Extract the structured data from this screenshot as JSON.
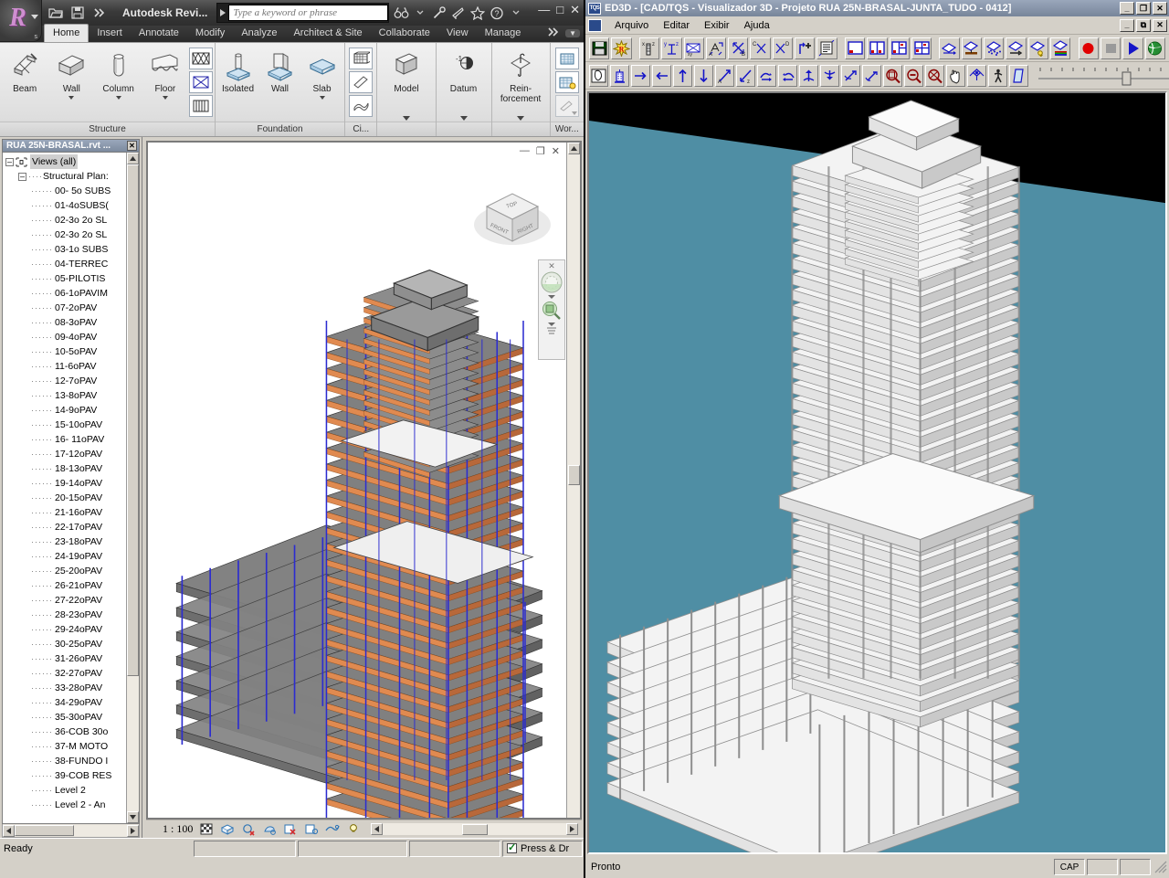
{
  "revit": {
    "app_title": "Autodesk Revi...",
    "search_placeholder": "Type a keyword or phrase",
    "window_buttons": {
      "minimize": "—",
      "maximize": "□",
      "close": "✕"
    },
    "quick_access": [
      {
        "name": "open-icon",
        "label": "Open"
      },
      {
        "name": "save-icon",
        "label": "Save"
      },
      {
        "name": "qat-more-icon",
        "label": "More"
      }
    ],
    "title_icons": [
      {
        "name": "infocenter-search-icon",
        "label": "Search"
      },
      {
        "name": "subscription-icon",
        "label": "Subscription Center"
      },
      {
        "name": "communication-icon",
        "label": "Communication Center"
      },
      {
        "name": "favorites-icon",
        "label": "Favorites"
      },
      {
        "name": "help-icon",
        "label": "Help"
      }
    ],
    "tabs": [
      {
        "label": "Home",
        "active": true
      },
      {
        "label": "Insert",
        "active": false
      },
      {
        "label": "Annotate",
        "active": false
      },
      {
        "label": "Modify",
        "active": false
      },
      {
        "label": "Analyze",
        "active": false
      },
      {
        "label": "Architect & Site",
        "active": false
      },
      {
        "label": "Collaborate",
        "active": false
      },
      {
        "label": "View",
        "active": false
      },
      {
        "label": "Manage",
        "active": false
      }
    ],
    "ribbon_panels": [
      {
        "label": "Structure",
        "buttons": [
          {
            "label": "Beam",
            "icon": "beam-icon",
            "dropdown": false
          },
          {
            "label": "Wall",
            "icon": "structural-wall-icon",
            "dropdown": true
          },
          {
            "label": "Column",
            "icon": "column-icon",
            "dropdown": true
          },
          {
            "label": "Floor",
            "icon": "floor-icon",
            "dropdown": true
          }
        ],
        "mini_buttons": [
          {
            "icon": "truss-icon"
          },
          {
            "icon": "brace-icon"
          },
          {
            "icon": "beam-system-icon"
          }
        ]
      },
      {
        "label": "Foundation",
        "buttons": [
          {
            "label": "Isolated",
            "icon": "isolated-foundation-icon",
            "dropdown": false
          },
          {
            "label": "Wall",
            "icon": "wall-foundation-icon",
            "dropdown": false
          },
          {
            "label": "Slab",
            "icon": "slab-foundation-icon",
            "dropdown": true
          }
        ],
        "mini_buttons": []
      },
      {
        "label": "Ci...",
        "buttons": [],
        "mini_buttons": [
          {
            "icon": "rebar-mesh-icon"
          },
          {
            "icon": "cover-icon"
          },
          {
            "icon": "area-reinforcement-icon"
          }
        ]
      },
      {
        "label": "",
        "buttons": [
          {
            "label": "Model",
            "icon": "model-icon",
            "dropdown": false
          }
        ],
        "mini_buttons": [],
        "panel_dropdown": true
      },
      {
        "label": "",
        "buttons": [
          {
            "label": "Datum",
            "icon": "datum-icon",
            "dropdown": false
          }
        ],
        "mini_buttons": [],
        "panel_dropdown": true
      },
      {
        "label": "",
        "buttons": [
          {
            "label": "Rein-\nforcement",
            "icon": "reinforcement-icon",
            "dropdown": false
          }
        ],
        "mini_buttons": [],
        "panel_dropdown": true
      },
      {
        "label": "Wor...",
        "buttons": [],
        "mini_buttons": [
          {
            "icon": "workset-icon"
          },
          {
            "icon": "active-workset-icon"
          },
          {
            "icon": "edit-workset-icon"
          }
        ]
      }
    ],
    "browser": {
      "title": "RUA 25N-BRASAL.rvt ...",
      "close_label": "✕",
      "root": "Views (all)",
      "group": "Structural Plan:",
      "views": [
        "00- 5o SUBS",
        "01-4oSUBS(",
        "02-3o 2o SL",
        "02-3o 2o SL",
        "03-1o SUBS",
        "04-TERREC",
        "05-PILOTIS",
        "06-1oPAVIM",
        "07-2oPAV",
        "08-3oPAV",
        "09-4oPAV",
        "10-5oPAV",
        "11-6oPAV",
        "12-7oPAV",
        "13-8oPAV",
        "14-9oPAV",
        "15-10oPAV",
        "16- 11oPAV",
        "17-12oPAV",
        "18-13oPAV",
        "19-14oPAV",
        "20-15oPAV",
        "21-16oPAV",
        "22-17oPAV",
        "23-18oPAV",
        "24-19oPAV",
        "25-20oPAV",
        "26-21oPAV",
        "27-22oPAV",
        "28-23oPAV",
        "29-24oPAV",
        "30-25oPAV",
        "31-26oPAV",
        "32-27oPAV",
        "33-28oPAV",
        "34-29oPAV",
        "35-30oPAV",
        "36-COB 30o",
        "37-M MOTO",
        "38-FUNDO I",
        "39-COB RES",
        "Level 2",
        "Level 2 - An"
      ]
    },
    "view_controls": {
      "scale": "1 : 100",
      "icons": [
        {
          "name": "detail-level-icon"
        },
        {
          "name": "visual-style-icon"
        },
        {
          "name": "sun-path-icon"
        },
        {
          "name": "shadows-icon"
        },
        {
          "name": "render-crop-icon"
        },
        {
          "name": "hide-isolate-icon"
        },
        {
          "name": "reveal-hidden-icon"
        },
        {
          "name": "temporary-view-icon"
        }
      ]
    },
    "mdi_buttons": {
      "minimize": "—",
      "restore": "❐",
      "close": "✕"
    },
    "status_text": "Ready",
    "press_drag_label": "Press & Dr",
    "viewcube": {
      "top": "TOP",
      "front": "FRONT",
      "right": "RIGHT"
    },
    "navbar": {
      "close": "✕",
      "items": [
        {
          "name": "steering-wheel-icon"
        },
        {
          "name": "zoom-tools-icon"
        },
        {
          "name": "navbar-customize-icon"
        }
      ]
    }
  },
  "ed3d": {
    "title": "ED3D - [CAD/TQS - Visualizador 3D - Projeto RUA 25N-BRASAL-JUNTA_TUDO - 0412]",
    "app_icon_label": "TQS",
    "window_buttons": {
      "minimize": "_",
      "maximize": "❐",
      "close": "✕"
    },
    "mdi_buttons": {
      "minimize": "_",
      "restore": "⧉",
      "close": "✕"
    },
    "menus": [
      {
        "label": "Arquivo"
      },
      {
        "label": "Editar"
      },
      {
        "label": "Exibir"
      },
      {
        "label": "Ajuda"
      }
    ],
    "toolbar_row1": [
      {
        "name": "save-icon",
        "group": 0
      },
      {
        "name": "refresh-icon",
        "group": 0
      },
      {
        "name": "view-xz-icon",
        "group": 1
      },
      {
        "name": "view-yz-icon",
        "group": 1
      },
      {
        "name": "view-xy-icon",
        "group": 1
      },
      {
        "name": "view-a-icon",
        "group": 1
      },
      {
        "name": "view-b-icon",
        "group": 1
      },
      {
        "name": "view-c-icon",
        "group": 1
      },
      {
        "name": "view-d-icon",
        "group": 1
      },
      {
        "name": "add-view-icon",
        "group": 1
      },
      {
        "name": "list-views-icon",
        "group": 1
      },
      {
        "name": "single-window-icon",
        "group": 2
      },
      {
        "name": "split-vertical-icon",
        "group": 2
      },
      {
        "name": "split-three-icon",
        "group": 2
      },
      {
        "name": "split-four-icon",
        "group": 2
      },
      {
        "name": "shade-flat-icon",
        "group": 3
      },
      {
        "name": "shade-section-icon",
        "group": 3
      },
      {
        "name": "shade-mesh-icon",
        "group": 3
      },
      {
        "name": "shade-arrow-icon",
        "group": 3
      },
      {
        "name": "shade-light-icon",
        "group": 3
      },
      {
        "name": "shade-color-icon",
        "group": 3
      },
      {
        "name": "record-icon",
        "group": 4
      },
      {
        "name": "stop-icon",
        "group": 4
      },
      {
        "name": "play-icon",
        "group": 4
      },
      {
        "name": "globe-icon",
        "group": 4
      }
    ],
    "toolbar_row2": [
      {
        "name": "select-icon",
        "group": 0
      },
      {
        "name": "building-icon",
        "group": 0
      },
      {
        "name": "pan-right-icon",
        "group": 1
      },
      {
        "name": "pan-left-icon",
        "group": 1
      },
      {
        "name": "pan-up-icon",
        "group": 1
      },
      {
        "name": "pan-down-icon",
        "group": 1
      },
      {
        "name": "move-a-icon",
        "group": 1
      },
      {
        "name": "move-z-icon",
        "group": 1
      },
      {
        "name": "rotate-x-icon",
        "group": 2
      },
      {
        "name": "rotate-y-icon",
        "group": 2
      },
      {
        "name": "rotate-z-icon",
        "group": 2
      },
      {
        "name": "rotate-free-icon",
        "group": 2
      },
      {
        "name": "orbit-icon",
        "group": 2
      },
      {
        "name": "spin-icon",
        "group": 2
      },
      {
        "name": "zoom-window-icon",
        "group": 3
      },
      {
        "name": "zoom-out-icon",
        "group": 3
      },
      {
        "name": "zoom-extents-icon",
        "group": 3
      },
      {
        "name": "pan-hand-icon",
        "group": 3
      },
      {
        "name": "perspective-icon",
        "group": 4
      },
      {
        "name": "walk-icon",
        "group": 4
      },
      {
        "name": "clip-plane-icon",
        "group": 5
      }
    ],
    "status_text": "Pronto",
    "status_cells": [
      "CAP",
      "",
      ""
    ]
  },
  "colors": {
    "ed3d_sky": "#000000",
    "ed3d_ground": "#4f8ea4",
    "ed3d_model": "#e8e8e8",
    "revit_canvas_bg": "#ffffff",
    "revit_model_fill": "#808080",
    "revit_model_edge": "#e08a50",
    "revit_accent_blue": "#2c2cd0",
    "chrome_face": "#d4d0c8",
    "title_blue": "#7c8a9e"
  }
}
